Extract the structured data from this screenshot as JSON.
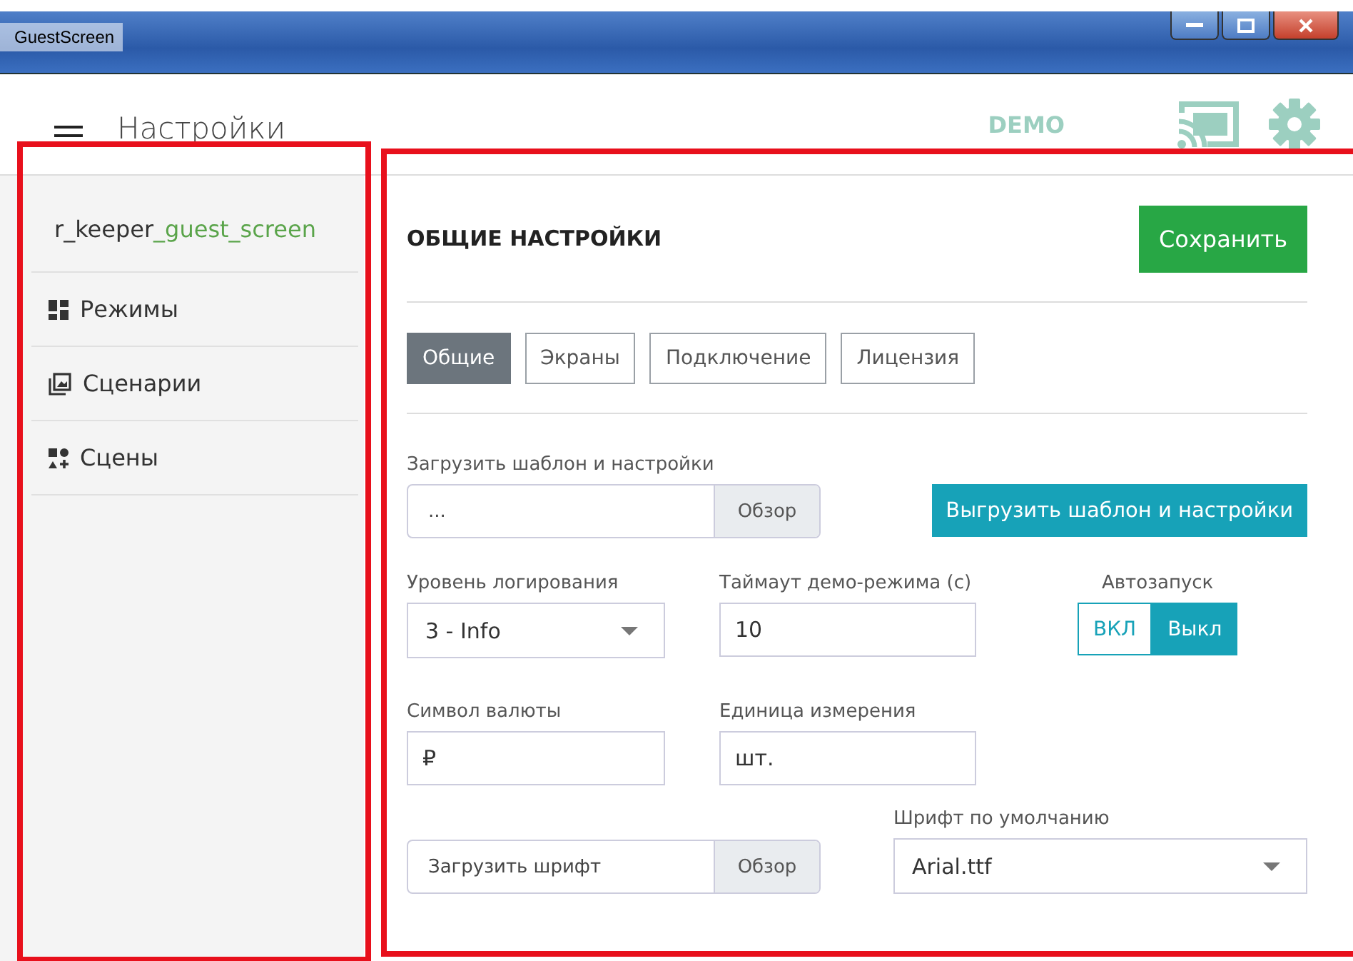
{
  "window": {
    "title": "GuestScreen"
  },
  "header": {
    "title": "Настройки",
    "badge": "DEMO"
  },
  "sidebar": {
    "brand": {
      "prefix": "r_keeper",
      "suffix": "_guest_screen"
    },
    "items": [
      {
        "label": "Режимы"
      },
      {
        "label": "Сценарии"
      },
      {
        "label": "Сцены"
      }
    ]
  },
  "panel": {
    "title": "ОБЩИЕ НАСТРОЙКИ",
    "save_button": "Сохранить",
    "tabs": [
      {
        "label": "Общие",
        "selected": true
      },
      {
        "label": "Экраны",
        "selected": false
      },
      {
        "label": "Подключение",
        "selected": false
      },
      {
        "label": "Лицензия",
        "selected": false
      }
    ],
    "template": {
      "label": "Загрузить шаблон и настройки",
      "value": "...",
      "browse": "Обзор"
    },
    "export_button": "Выгрузить шаблон и настройки",
    "log_level": {
      "label": "Уровень логирования",
      "value": "3 - Info"
    },
    "demo_timeout": {
      "label": "Таймаут демо-режима (с)",
      "value": "10"
    },
    "autostart": {
      "label": "Автозапуск",
      "options": [
        {
          "label": "ВКЛ",
          "selected": false
        },
        {
          "label": "Выкл",
          "selected": true
        }
      ]
    },
    "currency": {
      "label": "Символ валюты",
      "value": "₽"
    },
    "unit": {
      "label": "Единица измерения",
      "value": "шт."
    },
    "font_upload": {
      "value": "Загрузить шрифт",
      "browse": "Обзор"
    },
    "default_font": {
      "label": "Шрифт по умолчанию",
      "value": "Arial.ttf"
    }
  }
}
